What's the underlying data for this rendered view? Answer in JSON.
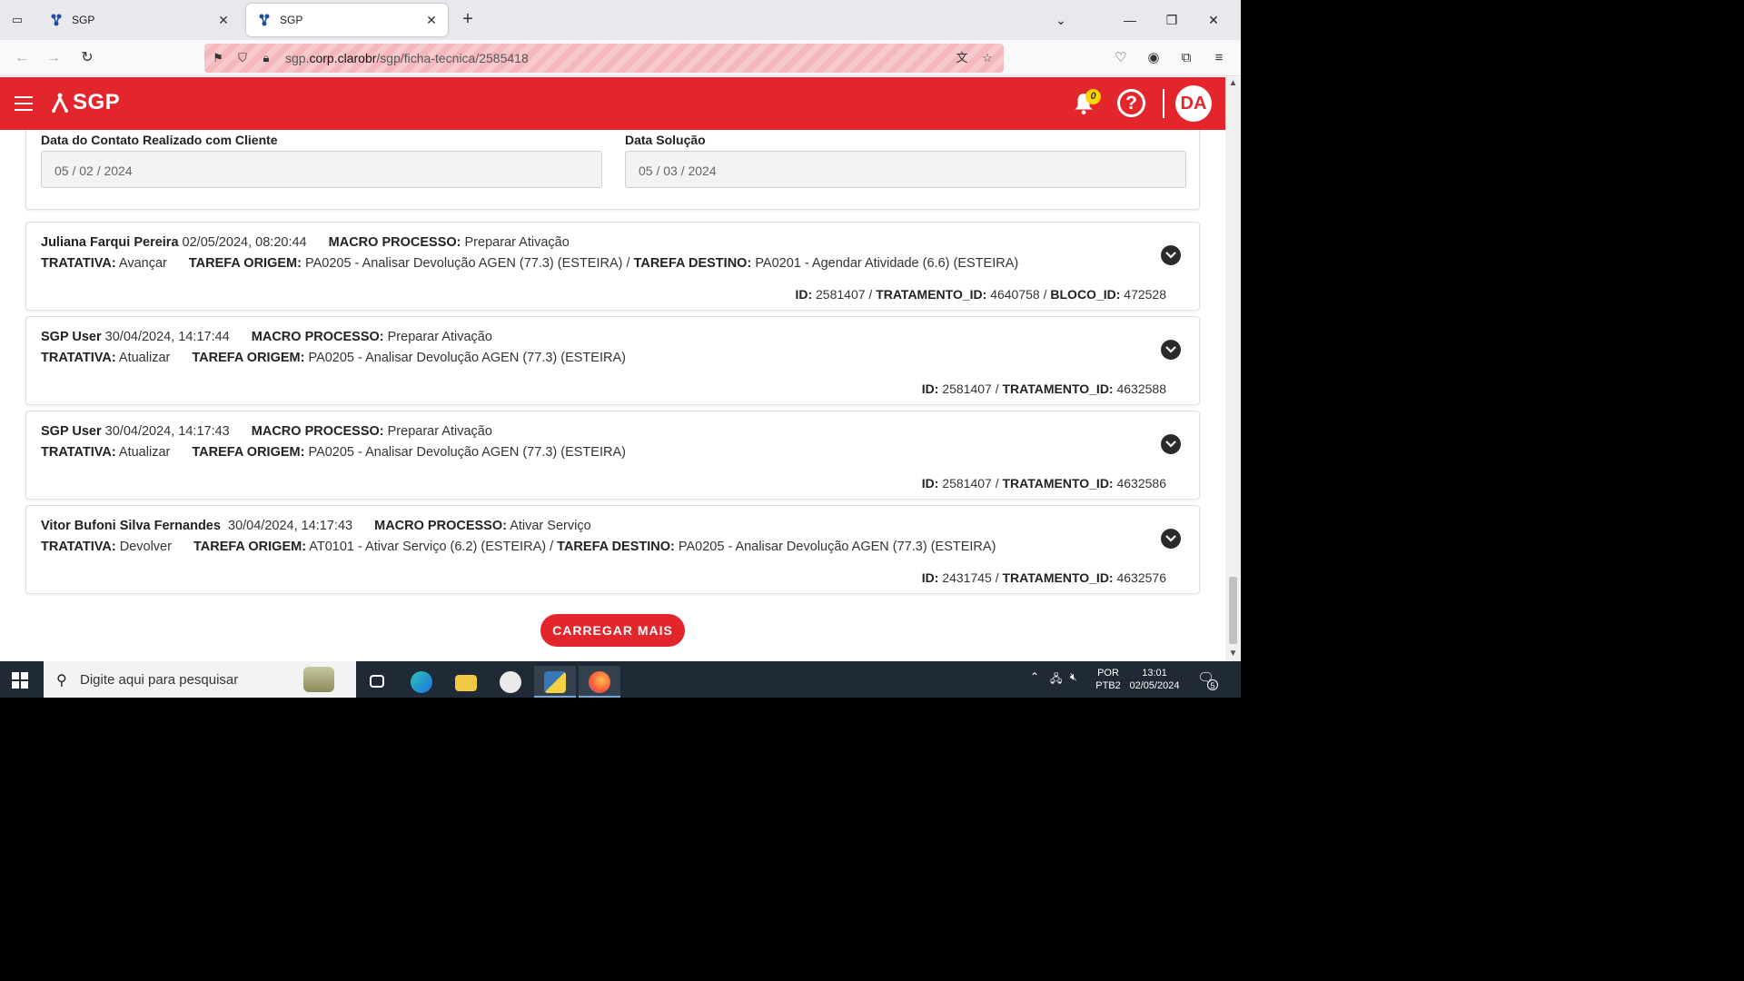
{
  "browser": {
    "tabs": [
      {
        "title": "SGP",
        "active": false
      },
      {
        "title": "SGP",
        "active": true
      }
    ],
    "url_prefix": "sgp.",
    "url_domain": "corp.clarobr",
    "url_path": "/sgp/ficha-tecnica/2585418"
  },
  "app": {
    "logo_text": "SGP",
    "notification_count": "0",
    "help_label": "?",
    "user_initials": "DA",
    "brand_color": "#e3262c"
  },
  "form": {
    "contact_label": "Data do Contato Realizado com Cliente",
    "contact_value": "05 / 02 / 2024",
    "solution_label": "Data Solução",
    "solution_value": "05 / 03 / 2024"
  },
  "history": [
    {
      "user": "Juliana Farqui Pereira",
      "datetime": "02/05/2024, 08:20:44",
      "macro_label": "MACRO PROCESSO:",
      "macro": "Preparar Ativação",
      "tratativa_label": "TRATATIVA:",
      "tratativa": "Avançar",
      "origem_label": "TAREFA ORIGEM:",
      "origem": "PA0205 - Analisar Devolução AGEN (77.3) (ESTEIRA)",
      "destino_label": "TAREFA DESTINO:",
      "destino": "PA0201 - Agendar Atividade (6.6) (ESTEIRA)",
      "id_label": "ID:",
      "id": "2581407",
      "tratamento_label": "TRATAMENTO_ID:",
      "tratamento": "4640758",
      "bloco_label": "BLOCO_ID:",
      "bloco": "472528"
    },
    {
      "user": "SGP User",
      "datetime": "30/04/2024, 14:17:44",
      "macro_label": "MACRO PROCESSO:",
      "macro": "Preparar Ativação",
      "tratativa_label": "TRATATIVA:",
      "tratativa": "Atualizar",
      "origem_label": "TAREFA ORIGEM:",
      "origem": "PA0205 - Analisar Devolução AGEN (77.3) (ESTEIRA)",
      "id_label": "ID:",
      "id": "2581407",
      "tratamento_label": "TRATAMENTO_ID:",
      "tratamento": "4632588"
    },
    {
      "user": "SGP User",
      "datetime": "30/04/2024, 14:17:43",
      "macro_label": "MACRO PROCESSO:",
      "macro": "Preparar Ativação",
      "tratativa_label": "TRATATIVA:",
      "tratativa": "Atualizar",
      "origem_label": "TAREFA ORIGEM:",
      "origem": "PA0205 - Analisar Devolução AGEN (77.3) (ESTEIRA)",
      "id_label": "ID:",
      "id": "2581407",
      "tratamento_label": "TRATAMENTO_ID:",
      "tratamento": "4632586"
    },
    {
      "user": "Vitor Bufoni Silva Fernandes",
      "datetime": "30/04/2024, 14:17:43",
      "macro_label": "MACRO PROCESSO:",
      "macro": "Ativar Serviço",
      "tratativa_label": "TRATATIVA:",
      "tratativa": "Devolver",
      "origem_label": "TAREFA ORIGEM:",
      "origem": "AT0101 - Ativar Serviço (6.2) (ESTEIRA)",
      "destino_label": "TAREFA DESTINO:",
      "destino": "PA0205 - Analisar Devolução AGEN (77.3) (ESTEIRA)",
      "id_label": "ID:",
      "id": "2431745",
      "tratamento_label": "TRATAMENTO_ID:",
      "tratamento": "4632576"
    }
  ],
  "separator": " / ",
  "load_more_label": "CARREGAR MAIS",
  "taskbar": {
    "search_placeholder": "Digite aqui para pesquisar",
    "lang_top": "POR",
    "lang_bottom": "PTB2",
    "time": "13:01",
    "date": "02/05/2024",
    "notifications": "5"
  }
}
